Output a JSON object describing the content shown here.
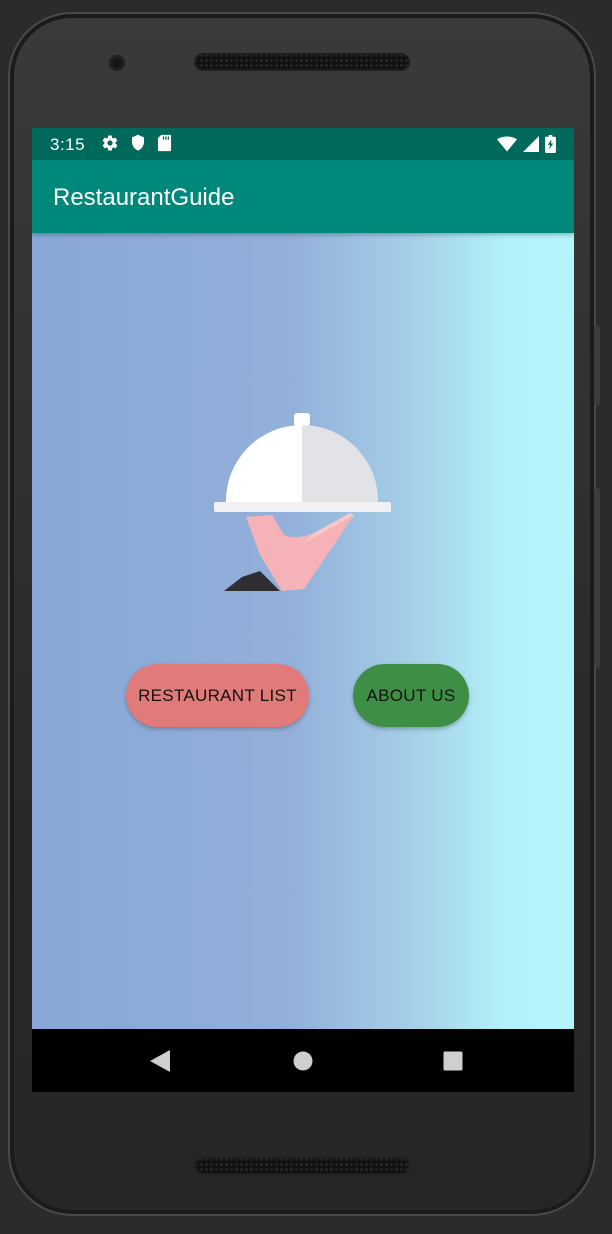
{
  "status_bar": {
    "time": "3:15",
    "icons_left": [
      "gear-icon",
      "shield-icon",
      "sd-card-icon"
    ],
    "icons_right": [
      "wifi-icon",
      "signal-icon",
      "battery-charging-icon"
    ]
  },
  "app_bar": {
    "title": "RestaurantGuide",
    "color": "#00897B"
  },
  "main": {
    "illustration": "waiter-hand-cloche-illustration",
    "buttons": {
      "restaurant_list": {
        "label": "RESTAURANT LIST",
        "color": "#E07B7A"
      },
      "about_us": {
        "label": "ABOUT US",
        "color": "#3E8F45"
      }
    },
    "background_gradient": [
      "#88A7D6",
      "#B4F4FA"
    ]
  },
  "nav_bar": {
    "items": [
      "back-icon",
      "home-icon",
      "recents-icon"
    ]
  }
}
